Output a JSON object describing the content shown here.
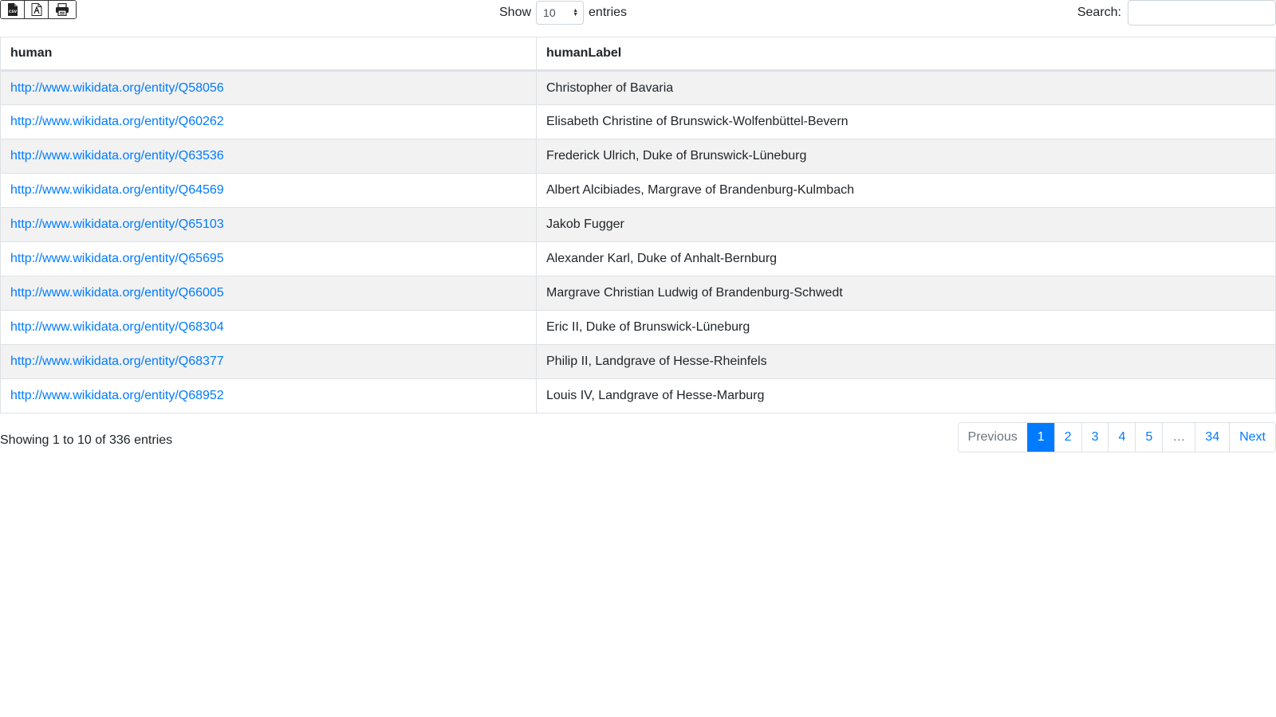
{
  "toolbar": {
    "export_buttons": [
      {
        "icon": "csv-file-icon"
      },
      {
        "icon": "pdf-file-icon"
      },
      {
        "icon": "printer-icon"
      }
    ],
    "show_label": "Show",
    "length_value": "10",
    "entries_label": "entries",
    "search_label": "Search:",
    "search_value": ""
  },
  "table": {
    "headers": [
      "human",
      "humanLabel"
    ],
    "rows": [
      {
        "human": "http://www.wikidata.org/entity/Q58056",
        "label": "Christopher of Bavaria"
      },
      {
        "human": "http://www.wikidata.org/entity/Q60262",
        "label": "Elisabeth Christine of Brunswick-Wolfenbüttel-Bevern"
      },
      {
        "human": "http://www.wikidata.org/entity/Q63536",
        "label": "Frederick Ulrich, Duke of Brunswick-Lüneburg"
      },
      {
        "human": "http://www.wikidata.org/entity/Q64569",
        "label": "Albert Alcibiades, Margrave of Brandenburg-Kulmbach"
      },
      {
        "human": "http://www.wikidata.org/entity/Q65103",
        "label": "Jakob Fugger"
      },
      {
        "human": "http://www.wikidata.org/entity/Q65695",
        "label": "Alexander Karl, Duke of Anhalt-Bernburg"
      },
      {
        "human": "http://www.wikidata.org/entity/Q66005",
        "label": "Margrave Christian Ludwig of Brandenburg-Schwedt"
      },
      {
        "human": "http://www.wikidata.org/entity/Q68304",
        "label": "Eric II, Duke of Brunswick-Lüneburg"
      },
      {
        "human": "http://www.wikidata.org/entity/Q68377",
        "label": "Philip II, Landgrave of Hesse-Rheinfels"
      },
      {
        "human": "http://www.wikidata.org/entity/Q68952",
        "label": "Louis IV, Landgrave of Hesse-Marburg"
      }
    ]
  },
  "info": "Showing 1 to 10 of 336 entries",
  "pagination": {
    "previous": "Previous",
    "pages": [
      "1",
      "2",
      "3",
      "4",
      "5",
      "…",
      "34"
    ],
    "active": "1",
    "next": "Next"
  },
  "colors": {
    "link": "#007bff",
    "active_page": "#007bff",
    "striped_row": "#f2f2f2"
  }
}
